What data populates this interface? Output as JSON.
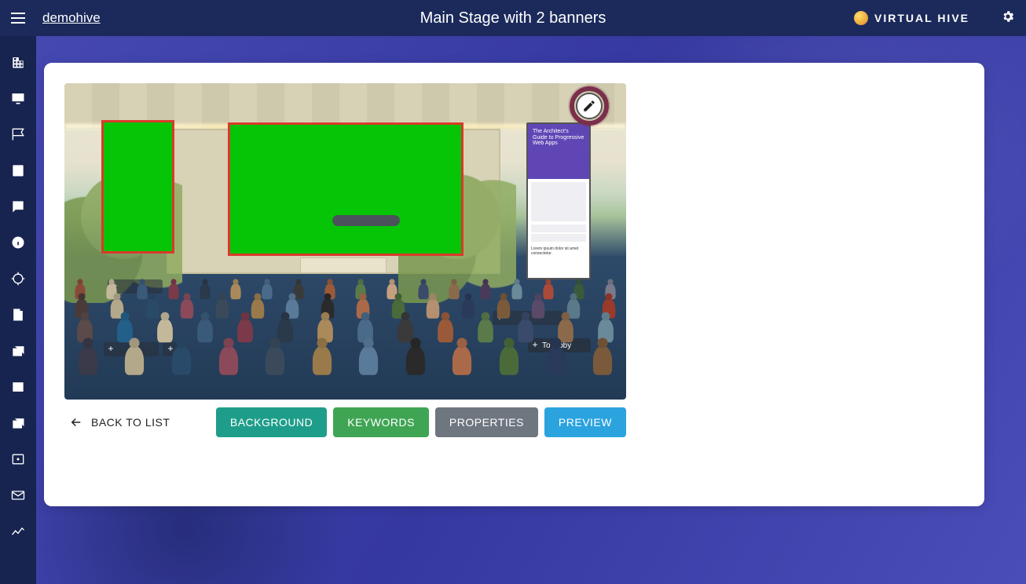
{
  "header": {
    "breadcrumb": "demohive",
    "title": "Main Stage with 2 banners",
    "brand": "VIRTUAL HIVE"
  },
  "sidebar": {
    "items": [
      {
        "name": "building-icon"
      },
      {
        "name": "screen-icon"
      },
      {
        "name": "flag-icon"
      },
      {
        "name": "calendar-icon"
      },
      {
        "name": "alert-icon"
      },
      {
        "name": "info-icon"
      },
      {
        "name": "target-icon"
      },
      {
        "name": "door-icon"
      },
      {
        "name": "gallery-icon"
      },
      {
        "name": "image-icon"
      },
      {
        "name": "video-library-icon"
      },
      {
        "name": "frame-icon"
      },
      {
        "name": "mail-icon"
      },
      {
        "name": "analytics-icon"
      }
    ]
  },
  "stage": {
    "panel_text": "The Architect's Guide to Progressive Web Apps",
    "hotspots": {
      "to_lobby": "To lobby"
    }
  },
  "toolbar": {
    "back": "BACK TO LIST",
    "background": "BACKGROUND",
    "keywords": "KEYWORDS",
    "properties": "PROPERTIES",
    "preview": "PREVIEW"
  }
}
